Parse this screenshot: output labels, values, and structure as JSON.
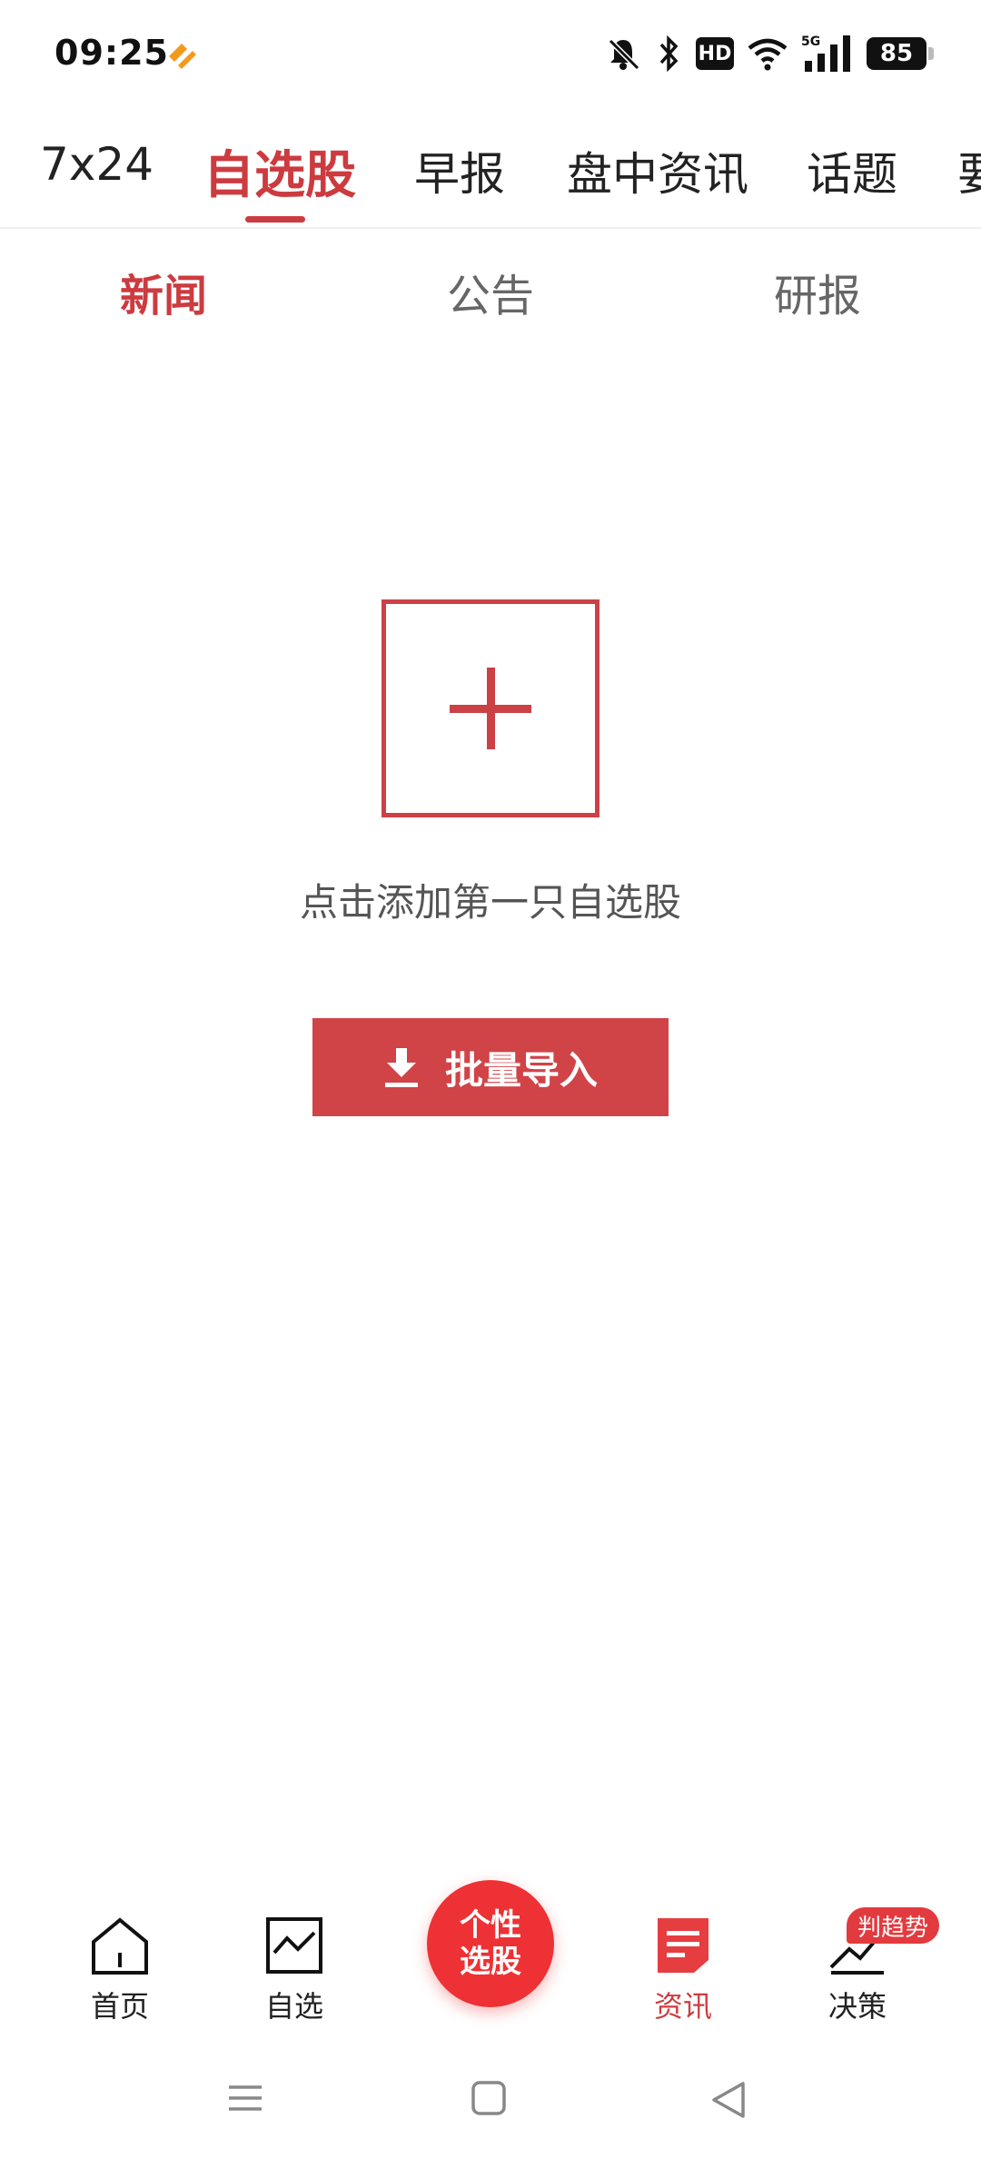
{
  "status_bar": {
    "time": "09:25",
    "hd_label": "HD",
    "network_label": "5G",
    "battery": "85"
  },
  "top_tabs": [
    {
      "label": "7x24"
    },
    {
      "label": "自选股",
      "active": true
    },
    {
      "label": "早报"
    },
    {
      "label": "盘中资讯"
    },
    {
      "label": "话题"
    },
    {
      "label": "要"
    }
  ],
  "sub_tabs": [
    {
      "label": "新闻",
      "active": true
    },
    {
      "label": "公告"
    },
    {
      "label": "研报"
    }
  ],
  "empty_state": {
    "message": "点击添加第一只自选股",
    "import_button": "批量导入"
  },
  "bottom_nav": {
    "items": [
      {
        "label": "首页",
        "icon": "home-icon"
      },
      {
        "label": "自选",
        "icon": "chart-icon"
      },
      {
        "label": "资讯",
        "icon": "news-icon",
        "active": true
      },
      {
        "label": "决策",
        "icon": "decision-icon"
      }
    ],
    "fab_line1": "个性",
    "fab_line2": "选股",
    "badge": "判趋势"
  },
  "colors": {
    "accent": "#cc3b3f",
    "fab": "#ee3134"
  }
}
